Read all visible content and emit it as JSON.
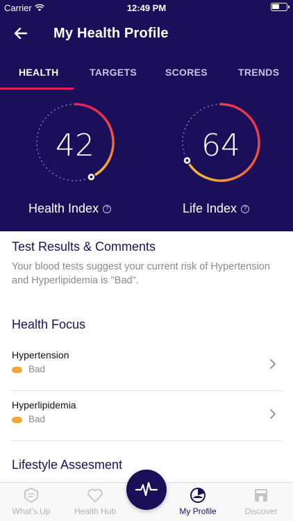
{
  "status_bar": {
    "carrier": "Carrier",
    "time": "12:49 PM"
  },
  "nav": {
    "title": "My Health Profile"
  },
  "tabs": [
    {
      "label": "HEALTH",
      "active": true
    },
    {
      "label": "TARGETS",
      "active": false
    },
    {
      "label": "SCORES",
      "active": false
    },
    {
      "label": "TRENDS",
      "active": false
    }
  ],
  "gauges": [
    {
      "value": "42",
      "label": "Health Index",
      "level": 0.42
    },
    {
      "value": "64",
      "label": "Life Index",
      "level": 0.64
    }
  ],
  "test_results": {
    "heading": "Test Results & Comments",
    "text": "Your blood tests suggest your current risk of Hypertension and Hyperlipidemia is \"Bad\"."
  },
  "health_focus": {
    "heading": "Health Focus",
    "items": [
      {
        "name": "Hypertension",
        "status": "Bad"
      },
      {
        "name": "Hyperlipidemia",
        "status": "Bad"
      }
    ]
  },
  "lifestyle": {
    "heading": "Lifestyle Assesment"
  },
  "tab_bar": [
    {
      "label": "What's Up",
      "icon": "chat-icon",
      "active": false
    },
    {
      "label": "Health Hub",
      "icon": "heart-icon",
      "active": false
    },
    {
      "label": "My Profile",
      "icon": "profile-icon",
      "active": true
    },
    {
      "label": "Discover",
      "icon": "store-icon",
      "active": false
    }
  ],
  "colors": {
    "header_bg": "#1c0f5a",
    "accent_red": "#e81f57",
    "gauge_yellow": "#f5c83c",
    "status_bad": "#f2a63a"
  }
}
